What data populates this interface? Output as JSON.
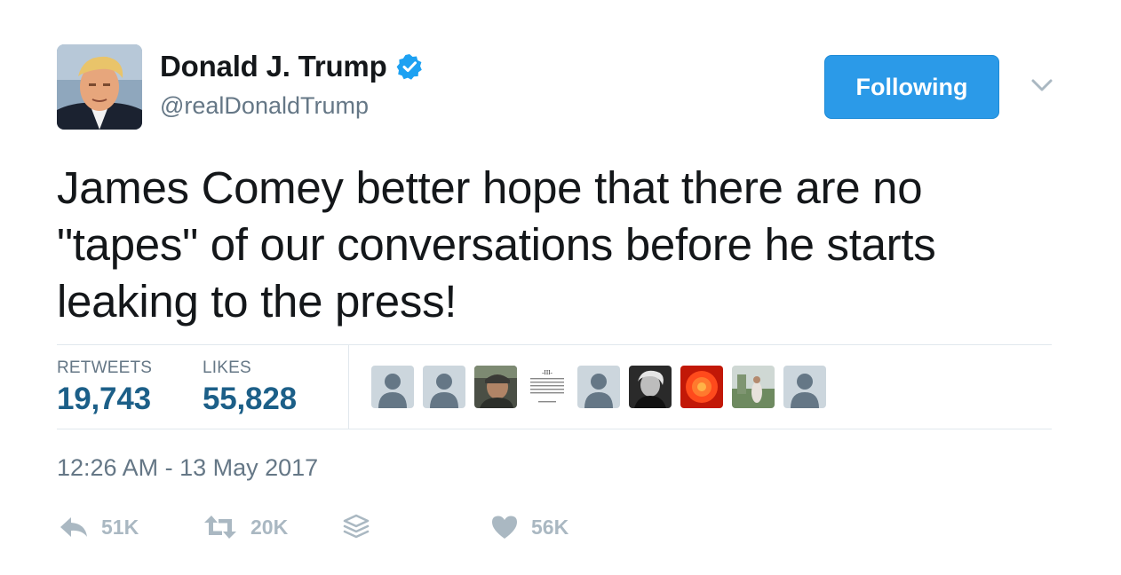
{
  "author": {
    "name": "Donald J. Trump",
    "handle": "@realDonaldTrump",
    "verified": true
  },
  "follow_button": {
    "label": "Following"
  },
  "tweet": {
    "text": "James Comey better hope that there are no \"tapes\" of our conversations before he starts leaking to the press!"
  },
  "stats": {
    "retweets_label": "RETWEETS",
    "retweets_value": "19,743",
    "likes_label": "LIKES",
    "likes_value": "55,828"
  },
  "likers": [
    {
      "icon": "default-avatar-icon"
    },
    {
      "icon": "default-avatar-icon"
    },
    {
      "icon": "photo-avatar"
    },
    {
      "icon": "document-avatar",
      "text": "-III-"
    },
    {
      "icon": "default-avatar-icon"
    },
    {
      "icon": "photo-avatar"
    },
    {
      "icon": "flower-avatar"
    },
    {
      "icon": "photo-avatar"
    },
    {
      "icon": "default-avatar-icon"
    }
  ],
  "timestamp": "12:26 AM - 13 May 2017",
  "actions": {
    "reply_count": "51K",
    "retweet_count": "20K",
    "like_count": "56K"
  },
  "colors": {
    "accent": "#2b9ae8",
    "stat_value": "#1c5f88",
    "muted": "#657786",
    "action_gray": "#aab8c2"
  }
}
